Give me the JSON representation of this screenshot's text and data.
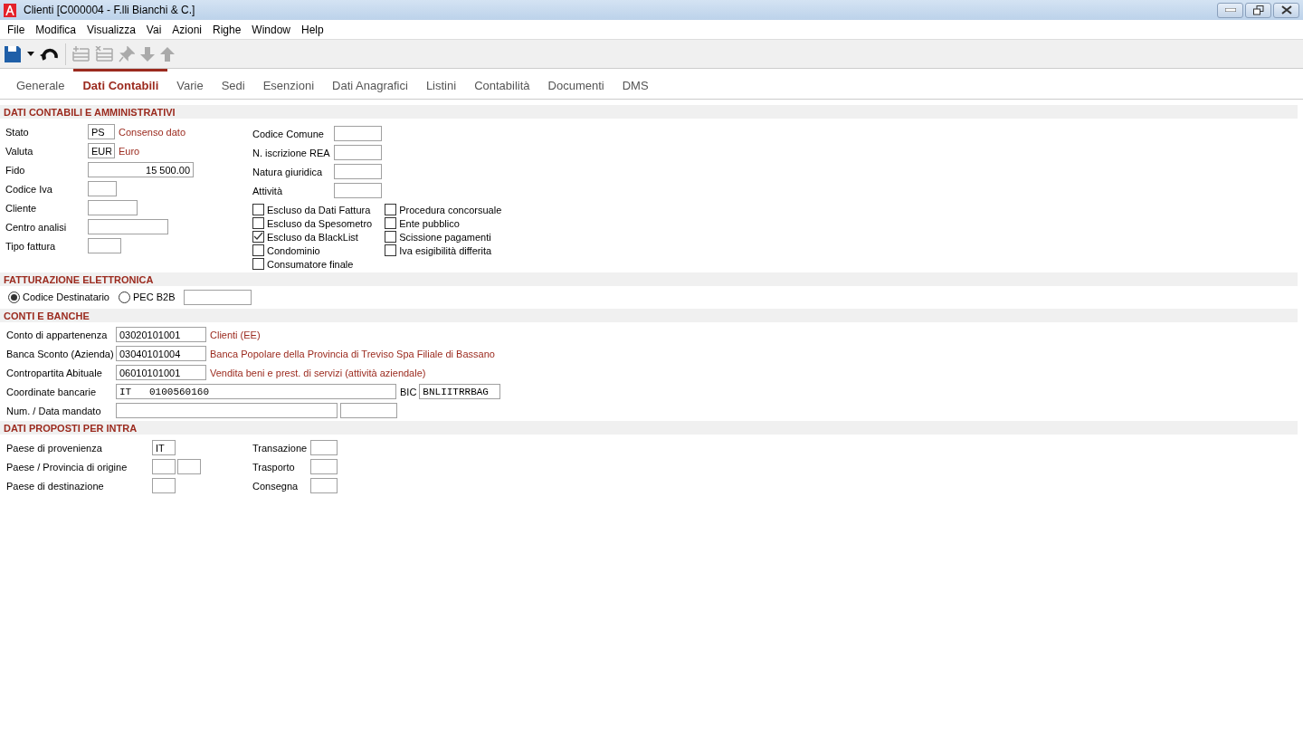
{
  "window": {
    "title": "Clienti [C000004 - F.lli Bianchi & C.]"
  },
  "menu": [
    "File",
    "Modifica",
    "Visualizza",
    "Vai",
    "Azioni",
    "Righe",
    "Window",
    "Help"
  ],
  "toolbar": [
    {
      "kind": "save",
      "disabled": false
    },
    {
      "kind": "dropdown",
      "disabled": false
    },
    {
      "kind": "undo",
      "disabled": false
    },
    {
      "kind": "add-row",
      "disabled": true
    },
    {
      "kind": "delete-row",
      "disabled": true
    },
    {
      "kind": "pin",
      "disabled": true
    },
    {
      "kind": "down",
      "disabled": true
    },
    {
      "kind": "up",
      "disabled": true
    }
  ],
  "tabs": [
    {
      "label": "Generale",
      "selected": false
    },
    {
      "label": "Dati Contabili",
      "selected": true
    },
    {
      "label": "Varie",
      "selected": false
    },
    {
      "label": "Sedi",
      "selected": false
    },
    {
      "label": "Esenzioni",
      "selected": false
    },
    {
      "label": "Dati Anagrafici",
      "selected": false
    },
    {
      "label": "Listini",
      "selected": false
    },
    {
      "label": "Contabilità",
      "selected": false
    },
    {
      "label": "Documenti",
      "selected": false
    },
    {
      "label": "DMS",
      "selected": false
    }
  ],
  "dati_contabili": {
    "title": "DATI CONTABILI E AMMINISTRATIVI",
    "fields_left": [
      {
        "label": "Stato",
        "value": "PS",
        "description": "Consenso dato"
      },
      {
        "label": "Valuta",
        "value": "EUR",
        "description": "Euro"
      },
      {
        "label": "Fido",
        "value": "15 500.00"
      },
      {
        "label": "Codice Iva"
      },
      {
        "label": "Cliente"
      },
      {
        "label": "Centro analisi"
      },
      {
        "label": "Tipo fattura"
      }
    ],
    "fields_right": [
      {
        "label": "Codice Comune"
      },
      {
        "label": "N. iscrizione REA"
      },
      {
        "label": "Natura giuridica"
      },
      {
        "label": "Attività"
      }
    ],
    "checkboxes_col1": [
      {
        "label": "Escluso da Dati Fattura",
        "checked": false
      },
      {
        "label": "Escluso da Spesometro",
        "checked": false
      },
      {
        "label": "Escluso da BlackList",
        "checked": true
      },
      {
        "label": "Condominio",
        "checked": false
      },
      {
        "label": "Consumatore finale",
        "checked": false
      }
    ],
    "checkboxes_col2": [
      {
        "label": "Procedura concorsuale",
        "checked": false
      },
      {
        "label": "Ente pubblico",
        "checked": false
      },
      {
        "label": "Scissione pagamenti",
        "checked": false
      },
      {
        "label": "Iva esigibilità differita",
        "checked": false
      }
    ]
  },
  "fatturazione_elettronica": {
    "title": "FATTURAZIONE ELETTRONICA",
    "options": [
      {
        "label": "Codice Destinatario",
        "selected": true
      },
      {
        "label": "PEC B2B",
        "selected": false
      }
    ]
  },
  "conti_e_banche": {
    "title": "CONTI E BANCHE",
    "accounts": [
      {
        "label": "Conto di appartenenza",
        "value": "03020101001",
        "description": "Clienti (EE)"
      },
      {
        "label": "Banca Sconto (Azienda)",
        "value": "03040101004",
        "description": "Banca Popolare della Provincia di Treviso Spa Filiale di Bassano"
      },
      {
        "label": "Contropartita Abituale",
        "value": "06010101001",
        "description": "Vendita beni e prest. di servizi (attività aziendale)"
      }
    ],
    "coordinate_bancarie": {
      "label": "Coordinate bancarie",
      "value": "IT   0100560160",
      "bic_label": "BIC",
      "bic_value": "BNLIITRRBAG"
    },
    "mandato": {
      "label": "Num. / Data mandato"
    }
  },
  "intra": {
    "title": "DATI PROPOSTI PER INTRA",
    "fields_left": [
      {
        "label": "Paese di provenienza",
        "kind": "single",
        "value": "IT"
      },
      {
        "label": "Paese / Provincia di origine",
        "kind": "double"
      },
      {
        "label": "Paese di destinazione",
        "kind": "single"
      }
    ],
    "fields_right": [
      {
        "label": "Transazione"
      },
      {
        "label": "Trasporto"
      },
      {
        "label": "Consegna"
      }
    ]
  }
}
